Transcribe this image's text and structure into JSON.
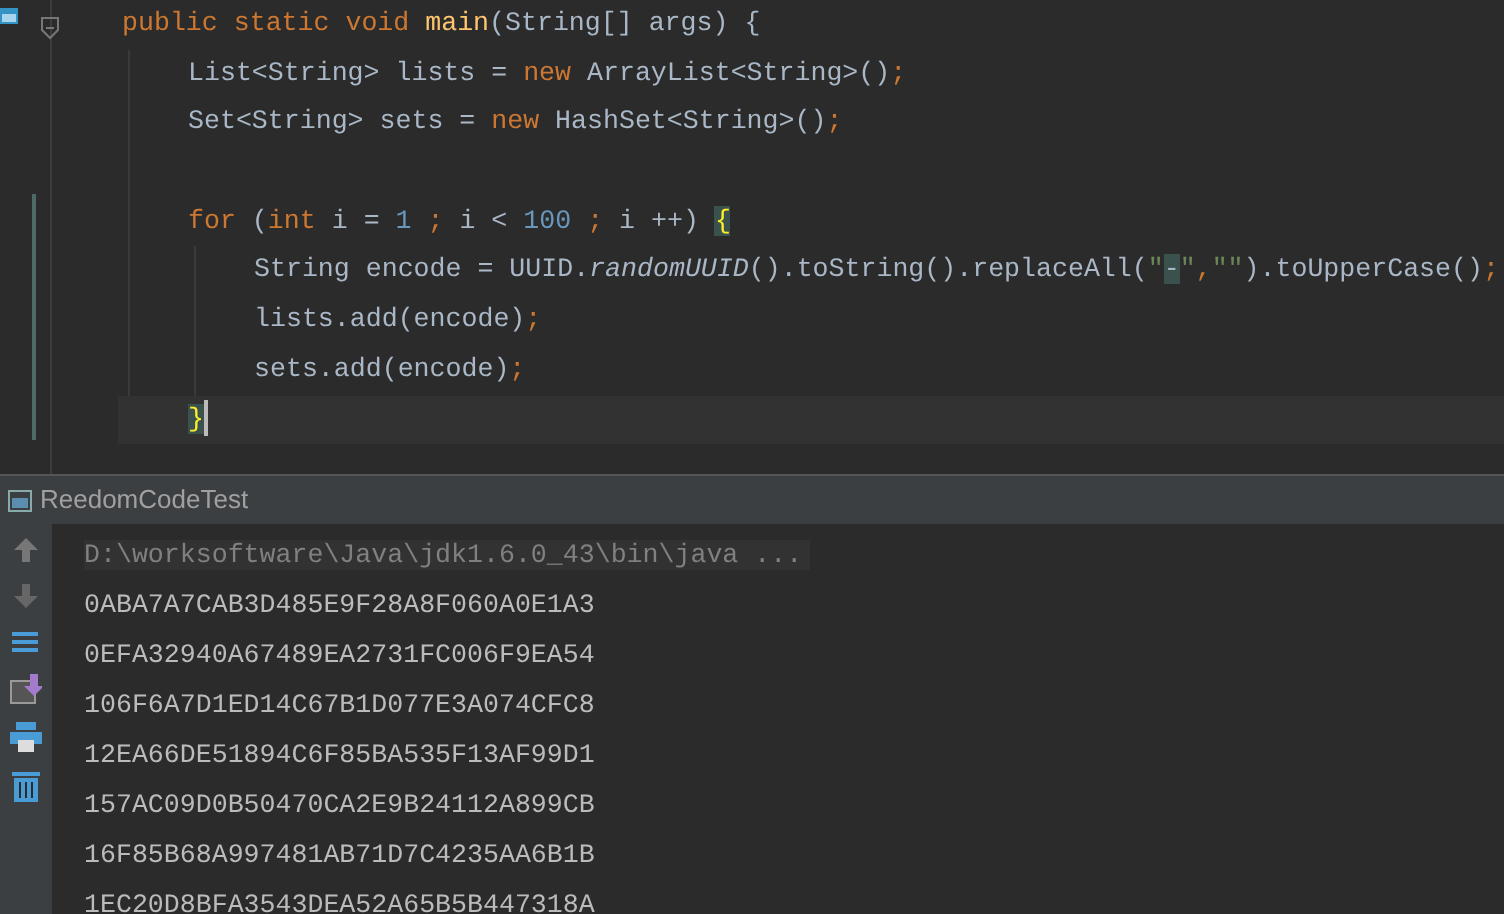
{
  "editor": {
    "lines": [
      {
        "current": false,
        "tokens": [
          {
            "kind": "keyword",
            "text": "public static void "
          },
          {
            "kind": "method",
            "text": "main"
          },
          {
            "kind": "plain",
            "text": "(String[] args) {"
          }
        ],
        "children": [
          {
            "current": false,
            "tokens": [
              {
                "kind": "plain",
                "text": "List<String> lists = "
              },
              {
                "kind": "keyword",
                "text": "new"
              },
              {
                "kind": "plain",
                "text": " ArrayList<String>()"
              },
              {
                "kind": "punct",
                "text": ";"
              }
            ]
          },
          {
            "current": false,
            "tokens": [
              {
                "kind": "plain",
                "text": "Set<String> sets = "
              },
              {
                "kind": "keyword",
                "text": "new"
              },
              {
                "kind": "plain",
                "text": " HashSet<String>()"
              },
              {
                "kind": "punct",
                "text": ";"
              }
            ]
          },
          {
            "current": false,
            "blank_line_before": true,
            "tokens": [
              {
                "kind": "keyword",
                "text": "for"
              },
              {
                "kind": "plain",
                "text": " ("
              },
              {
                "kind": "keyword",
                "text": "int"
              },
              {
                "kind": "plain",
                "text": " i = "
              },
              {
                "kind": "number",
                "text": "1"
              },
              {
                "kind": "punct",
                "text": " ; "
              },
              {
                "kind": "plain",
                "text": "i < "
              },
              {
                "kind": "number",
                "text": "100"
              },
              {
                "kind": "punct",
                "text": " ; "
              },
              {
                "kind": "plain",
                "text": "i ++) "
              },
              {
                "kind": "brace-match",
                "text": "{"
              }
            ],
            "children": [
              {
                "current": false,
                "tokens": [
                  {
                    "kind": "plain",
                    "text": "String encode = UUID."
                  },
                  {
                    "kind": "italic",
                    "text": "randomUUID"
                  },
                  {
                    "kind": "plain",
                    "text": "().toString().replaceAll("
                  },
                  {
                    "kind": "string",
                    "text": "\""
                  },
                  {
                    "kind": "string-match",
                    "text": "-"
                  },
                  {
                    "kind": "string",
                    "text": "\""
                  },
                  {
                    "kind": "punct",
                    "text": ","
                  },
                  {
                    "kind": "string",
                    "text": "\"\""
                  },
                  {
                    "kind": "plain",
                    "text": ").toUpperCase()"
                  },
                  {
                    "kind": "punct",
                    "text": ";"
                  }
                ]
              },
              {
                "current": false,
                "tokens": [
                  {
                    "kind": "plain",
                    "text": "lists.add(encode)"
                  },
                  {
                    "kind": "punct",
                    "text": ";"
                  }
                ]
              },
              {
                "current": false,
                "tokens": [
                  {
                    "kind": "plain",
                    "text": "sets.add(encode)"
                  },
                  {
                    "kind": "punct",
                    "text": ";"
                  }
                ]
              }
            ]
          },
          {
            "current": true,
            "tokens": [
              {
                "kind": "brace-match",
                "text": "}"
              }
            ]
          }
        ]
      }
    ]
  },
  "console": {
    "title": "ReedomCodeTest",
    "lines": [
      {
        "kind": "command",
        "text": "D:\\worksoftware\\Java\\jdk1.6.0_43\\bin\\java ..."
      },
      {
        "kind": "output",
        "text": "0ABA7A7CAB3D485E9F28A8F060A0E1A3"
      },
      {
        "kind": "output",
        "text": "0EFA32940A67489EA2731FC006F9EA54"
      },
      {
        "kind": "output",
        "text": "106F6A7D1ED14C67B1D077E3A074CFC8"
      },
      {
        "kind": "output",
        "text": "12EA66DE51894C6F85BA535F13AF99D1"
      },
      {
        "kind": "output",
        "text": "157AC09D0B50470CA2E9B24112A899CB"
      },
      {
        "kind": "output",
        "text": "16F85B68A997481AB71D7C4235AA6B1B"
      },
      {
        "kind": "output",
        "text": "1EC20D8BFA3543DEA52A65B5B447318A"
      }
    ]
  }
}
